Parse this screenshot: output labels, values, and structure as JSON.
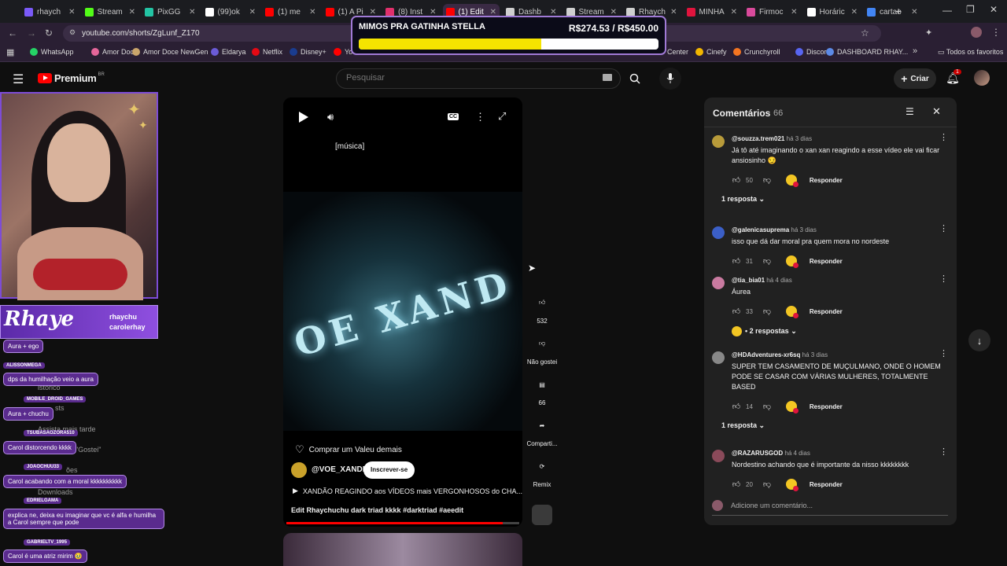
{
  "browser": {
    "tabs": [
      {
        "label": "rhaych",
        "color": "#7a5af8"
      },
      {
        "label": "Stream",
        "color": "#53fc18"
      },
      {
        "label": "PixGG",
        "color": "#23c4a4"
      },
      {
        "label": "(99)ok",
        "color": "#ffffff"
      },
      {
        "label": "(1) me",
        "color": "#ff0000"
      },
      {
        "label": "(1) A Pi",
        "color": "#ff0000"
      },
      {
        "label": "(8) Inst",
        "color": "#e1306c"
      },
      {
        "label": "(1) Edit",
        "color": "#ff0000"
      },
      {
        "label": "Dashb",
        "color": "#cfcfcf"
      },
      {
        "label": "Stream",
        "color": "#cfcfcf"
      },
      {
        "label": "Rhaych",
        "color": "#cfcfcf"
      },
      {
        "label": "MINHA",
        "color": "#e0143d"
      },
      {
        "label": "Firmoc",
        "color": "#d94a9b"
      },
      {
        "label": "Horáric",
        "color": "#ffffff"
      },
      {
        "label": "cartao",
        "color": "#4285f4"
      }
    ],
    "url": "youtube.com/shorts/ZgLunf_Z170",
    "bookmarks": [
      {
        "label": "WhatsApp",
        "color": "#25d366"
      },
      {
        "label": "Amor Doce",
        "color": "#e5669a"
      },
      {
        "label": "Amor Doce NewGen",
        "color": "#c9a56b"
      },
      {
        "label": "Eldarya",
        "color": "#6b5bd6"
      },
      {
        "label": "Netflix",
        "color": "#e50914"
      },
      {
        "label": "Disney+",
        "color": "#1a3c8f"
      },
      {
        "label": "Yo",
        "color": "#ff0000"
      },
      {
        "label": "Center",
        "color": "#2a1f33"
      },
      {
        "label": "Cinefy",
        "color": "#f2b600"
      },
      {
        "label": "Crunchyroll",
        "color": "#f47521"
      },
      {
        "label": "Discord",
        "color": "#5865f2"
      },
      {
        "label": "DASHBOARD RHAY...",
        "color": "#5c8ae6"
      }
    ],
    "bookmarks_overflow": "»",
    "all_favorites": "Todos os favoritos"
  },
  "goal_overlay": {
    "title": "MIMOS PRA GATINHA STELLA",
    "amount": "R$274.53 / R$450.00",
    "progress_fraction": 0.61,
    "bar_color": "#f5e400"
  },
  "youtube": {
    "logo_text": "Premium",
    "logo_region": "BR",
    "search_placeholder": "Pesquisar",
    "create_label": "Criar",
    "notif_count": "1"
  },
  "stream_overlay": {
    "brand": "Rhaye",
    "socials": [
      "rhaychu",
      "carolerhay"
    ],
    "chat": [
      {
        "user": "",
        "text": "Aura + ego"
      },
      {
        "user": "ALISSONMEGA",
        "text": "dps da humilhação veio a aura"
      },
      {
        "user": "MOBILE_DROID_GAMES",
        "text": "Aura + chuchu"
      },
      {
        "user": "TSUBASAOZORA510",
        "text": "Carol distorcendo kkkk"
      },
      {
        "user": "JOAOCHUU33",
        "text": "Carol acabando com a moral kkkkkkkkkk"
      },
      {
        "user": "EDRIELGAMA",
        "text": "explica ne, deixa eu imaginar que vc é alfa e humilha a Carol sempre que pode"
      },
      {
        "user": "GABRIELTV_1995",
        "text": "Carol é uma atriz mirim 🥹"
      }
    ],
    "ghost_texts": [
      "istórico",
      "sts",
      "Assista mais tarde",
      "\"Gostei\"",
      "ões",
      "Downloads"
    ]
  },
  "player": {
    "caption": "[música]",
    "video_text": "OE XAND",
    "thanks_label": "Comprar um Valeu demais",
    "channel": "@VOE_XANDE",
    "subscribe_label": "Inscrever-se",
    "playlist_title": "XANDÃO REAGINDO aos VÍDEOS mais VERGONHOSOS do CHA...",
    "description": "Edit Rhaychuchu dark triad kkkk",
    "hashtags": "#darktriad #aeedit",
    "progress_fraction": 0.93
  },
  "actions": [
    {
      "icon": "like-icon",
      "label": "532"
    },
    {
      "icon": "dislike-icon",
      "label": "Não gostei"
    },
    {
      "icon": "comment-icon",
      "label": "66"
    },
    {
      "icon": "share-icon",
      "label": "Comparti..."
    },
    {
      "icon": "remix-icon",
      "label": "Remix"
    }
  ],
  "comments": {
    "title": "Comentários",
    "count": "66",
    "reply_label": "Responder",
    "add_placeholder": "Adicione um comentário...",
    "items": [
      {
        "author": "@souzza.trem021",
        "time": "há 3 dias",
        "text": "Já tô até imaginando o xan xan reagindo a esse vídeo ele vai ficar ansiosinho 😏",
        "likes": "50",
        "replies": "1 resposta",
        "avatar_color": "#b89b3a"
      },
      {
        "author": "@galenicasuprema",
        "time": "há 3 dias",
        "text": "isso que dá dar moral pra quem mora no nordeste",
        "likes": "31",
        "replies": "",
        "avatar_color": "#3b5fc7"
      },
      {
        "author": "@tia_bia01",
        "time": "há 4 dias",
        "text": "Áurea",
        "likes": "33",
        "replies": "• 2 respostas",
        "avatar_color": "#c97aa0"
      },
      {
        "author": "@HDAdventures-xr6sq",
        "time": "há 3 dias",
        "text": "SUPER TEM CASAMENTO DE MUÇULMANO, ONDE O HOMEM PODE SE CASAR COM VÁRIAS MULHERES, TOTALMENTE BASED",
        "likes": "14",
        "replies": "1 resposta",
        "avatar_color": "#888888"
      },
      {
        "author": "@RAZARUSGOD",
        "time": "há 4 dias",
        "text": "Nordestino achando que é importante da nisso kkkkkkkk",
        "likes": "20",
        "replies": "",
        "avatar_color": "#8a4a5a"
      }
    ]
  }
}
